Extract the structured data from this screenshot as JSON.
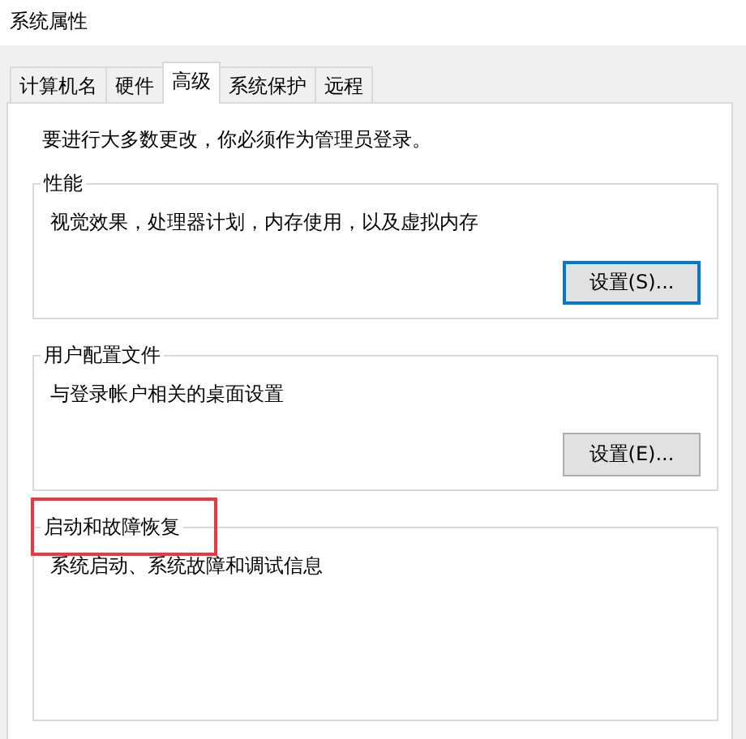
{
  "window": {
    "title": "系统属性"
  },
  "tabs": [
    {
      "label": "计算机名",
      "selected": false
    },
    {
      "label": "硬件",
      "selected": false
    },
    {
      "label": "高级",
      "selected": true
    },
    {
      "label": "系统保护",
      "selected": false
    },
    {
      "label": "远程",
      "selected": false
    }
  ],
  "notice": "要进行大多数更改，你必须作为管理员登录。",
  "groups": [
    {
      "title": "性能",
      "description": "视觉效果，处理器计划，内存使用，以及虚拟内存",
      "button": {
        "label": "设置(S)...",
        "focused": true
      },
      "highlighted": false
    },
    {
      "title": "用户配置文件",
      "description": "与登录帐户相关的桌面设置",
      "button": {
        "label": "设置(E)...",
        "focused": false
      },
      "highlighted": false
    },
    {
      "title": "启动和故障恢复",
      "description": "系统启动、系统故障和调试信息",
      "highlighted": true
    }
  ]
}
